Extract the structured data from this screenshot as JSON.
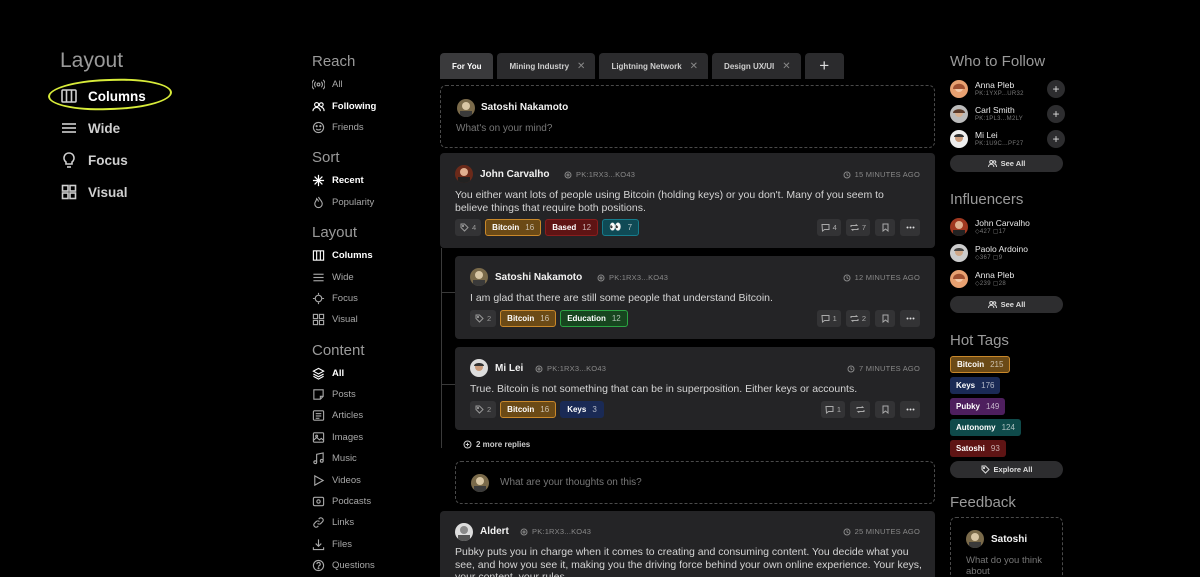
{
  "layout_panel": {
    "title": "Layout",
    "items": [
      {
        "label": "Columns",
        "icon": "columns-icon",
        "active": true
      },
      {
        "label": "Wide",
        "icon": "wide-icon"
      },
      {
        "label": "Focus",
        "icon": "focus-icon"
      },
      {
        "label": "Visual",
        "icon": "visual-icon"
      }
    ]
  },
  "filters": {
    "reach": {
      "title": "Reach",
      "items": [
        {
          "label": "All"
        },
        {
          "label": "Following",
          "active": true
        },
        {
          "label": "Friends"
        }
      ]
    },
    "sort": {
      "title": "Sort",
      "items": [
        {
          "label": "Recent",
          "active": true
        },
        {
          "label": "Popularity"
        }
      ]
    },
    "layout": {
      "title": "Layout",
      "items": [
        {
          "label": "Columns",
          "active": true
        },
        {
          "label": "Wide"
        },
        {
          "label": "Focus"
        },
        {
          "label": "Visual"
        }
      ]
    },
    "content": {
      "title": "Content",
      "items": [
        {
          "label": "All",
          "active": true
        },
        {
          "label": "Posts"
        },
        {
          "label": "Articles"
        },
        {
          "label": "Images"
        },
        {
          "label": "Music"
        },
        {
          "label": "Videos"
        },
        {
          "label": "Podcasts"
        },
        {
          "label": "Links"
        },
        {
          "label": "Files"
        },
        {
          "label": "Questions"
        }
      ]
    }
  },
  "tabs": [
    {
      "label": "For You",
      "active": true
    },
    {
      "label": "Mining Industry"
    },
    {
      "label": "Lightning Network"
    },
    {
      "label": "Design UX/UI"
    }
  ],
  "tab_close_glyph": "✕",
  "tab_add_glyph": "+",
  "composer": {
    "user": "Satoshi Nakamoto",
    "placeholder": "What's on your mind?"
  },
  "posts": [
    {
      "author": "John Carvalho",
      "pk": "PK:1RX3...KO43",
      "time": "15 MINUTES AGO",
      "text": "You either want lots of people using Bitcoin (holding keys) or you don't. Many of you seem to believe things that require both positions.",
      "tag_count": "4",
      "tags": [
        {
          "label": "Bitcoin",
          "count": "16",
          "color": "#6b4a16",
          "border": "#c9882a"
        },
        {
          "label": "Based",
          "count": "12",
          "color": "#5e1414",
          "border": "#8a1d1d"
        },
        {
          "label": "👀",
          "count": "7",
          "color": "#0f4a55",
          "border": "#167c8c"
        }
      ],
      "replies": "4",
      "reposts": "7"
    },
    {
      "author": "Satoshi Nakamoto",
      "pk": "PK:1RX3...KO43",
      "time": "12 MINUTES AGO",
      "text": "I am glad that there are still some people that understand Bitcoin.",
      "tag_count": "2",
      "tags": [
        {
          "label": "Bitcoin",
          "count": "16",
          "color": "#6b4a16",
          "border": "#c9882a"
        },
        {
          "label": "Education",
          "count": "12",
          "color": "#17451f",
          "border": "#2ba443"
        }
      ],
      "replies": "1",
      "reposts": "2"
    },
    {
      "author": "Mi Lei",
      "pk": "PK:1RX3...KO43",
      "time": "7 MINUTES AGO",
      "text": "True. Bitcoin is not something that can be in superposition. Either keys or accounts.",
      "tag_count": "2",
      "tags": [
        {
          "label": "Bitcoin",
          "count": "16",
          "color": "#6b4a16",
          "border": "#c9882a"
        },
        {
          "label": "Keys",
          "count": "3",
          "color": "#1a2a55",
          "border": "#1a2a55"
        }
      ],
      "replies": "1",
      "reposts": ""
    },
    {
      "author": "Aldert",
      "pk": "PK:1RX3...KO43",
      "time": "25 MINUTES AGO",
      "text": "Pubky puts you in charge when it comes to creating and consuming content. You decide what you see, and how you see it, making you the driving force behind your own online experience. Your keys, your content, your rules."
    }
  ],
  "more_replies": "2 more replies",
  "reply_placeholder": "What are your thoughts on this?",
  "who_to_follow": {
    "title": "Who to Follow",
    "people": [
      {
        "name": "Anna Pleb",
        "pk": "PK:1YXP...UR32"
      },
      {
        "name": "Carl Smith",
        "pk": "PK:1PL3...M2LY"
      },
      {
        "name": "Mi Lei",
        "pk": "PK:1U9C...PF27"
      }
    ],
    "see_all": "See All"
  },
  "influencers": {
    "title": "Influencers",
    "people": [
      {
        "name": "John Carvalho",
        "tags": "427",
        "posts": "17"
      },
      {
        "name": "Paolo Ardoino",
        "tags": "367",
        "posts": "9"
      },
      {
        "name": "Anna Pleb",
        "tags": "239",
        "posts": "28"
      }
    ],
    "see_all": "See All"
  },
  "hot_tags": {
    "title": "Hot Tags",
    "tags": [
      {
        "label": "Bitcoin",
        "count": "215",
        "color": "#6b4a16",
        "border": "#c9882a"
      },
      {
        "label": "Keys",
        "count": "176",
        "color": "#1a2a55",
        "border": "#1a2a55"
      },
      {
        "label": "Pubky",
        "count": "149",
        "color": "#4e1f5e",
        "border": "#4e1f5e"
      },
      {
        "label": "Autonomy",
        "count": "124",
        "color": "#0f4a4a",
        "border": "#0f4a4a"
      },
      {
        "label": "Satoshi",
        "count": "93",
        "color": "#5e1414",
        "border": "#5e1414"
      }
    ],
    "explore": "Explore All"
  },
  "feedback": {
    "title": "Feedback",
    "user": "Satoshi",
    "placeholder": "What do you think about"
  },
  "accent": "#d8ec3a"
}
